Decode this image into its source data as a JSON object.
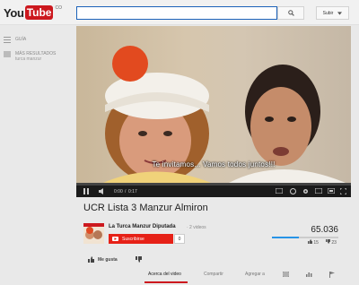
{
  "header": {
    "logo_you": "You",
    "logo_tube": "Tube",
    "logo_cc": "CO",
    "search_placeholder": "",
    "upload_label": "Subir"
  },
  "guide": {
    "guide_label": "GUÍA",
    "more_results_label": "MÁS RESULTADOS",
    "more_results_sub": "turca manzur"
  },
  "video": {
    "subtitle": "Te invitamos... Vamos todos juntos!!!",
    "time_current": "0:00",
    "time_total": "0:17",
    "progress": 0.0
  },
  "meta": {
    "title": "UCR Lista 3 Manzur Almiron",
    "channel_name": "La Turca Manzur Diputada",
    "channel_videos": "· 2 videos",
    "subscribe_label": "Suscribirse",
    "subscriber_count": "0",
    "views": "65.036",
    "likes": "15",
    "dislikes": "23",
    "like_ratio": 0.4,
    "like_label": "Me gusta"
  },
  "tabs": {
    "about": "Acerca del video",
    "share": "Compartir",
    "add_to": "Agregar a"
  },
  "colors": {
    "brand_red": "#cc181e",
    "subscribe_red": "#e62117",
    "search_border": "#1c62b9",
    "view_bar": "#2793e6"
  }
}
